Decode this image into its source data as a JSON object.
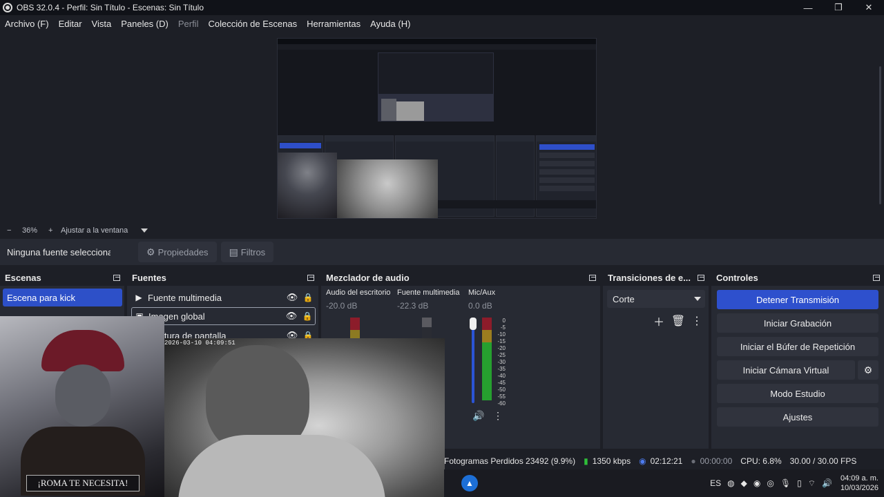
{
  "window": {
    "title": "OBS 32.0.4 - Perfil: Sin Título - Escenas: Sin Título"
  },
  "menu": [
    "Archivo (F)",
    "Editar",
    "Vista",
    "Paneles (D)",
    "Perfil",
    "Colección de Escenas",
    "Herramientas",
    "Ayuda (H)"
  ],
  "zoom": {
    "minus": "−",
    "percent": "36%",
    "plus": "+",
    "fit": "Ajustar a la ventana"
  },
  "context": {
    "no_source": "Ninguna fuente seleccionada",
    "properties": "Propiedades",
    "filters": "Filtros"
  },
  "docks": {
    "scenes": {
      "title": "Escenas",
      "items": [
        "Escena para kick"
      ]
    },
    "sources": {
      "title": "Fuentes",
      "items": [
        "Fuente multimedia",
        "Imagen global",
        "Captura de pantalla"
      ]
    },
    "mixer": {
      "title": "Mezclador de audio",
      "channels": [
        {
          "name": "Audio del escritorio",
          "db": "-20.0 dB"
        },
        {
          "name": "Fuente multimedia",
          "db": "-22.3 dB"
        },
        {
          "name": "Mic/Aux",
          "db": "0.0 dB"
        }
      ],
      "scale": [
        "0",
        "-5",
        "-10",
        "-15",
        "-20",
        "-25",
        "-30",
        "-35",
        "-40",
        "-45",
        "-50",
        "-55",
        "-60"
      ]
    },
    "transitions": {
      "title": "Transiciones de e...",
      "selected": "Corte"
    },
    "controls": {
      "title": "Controles",
      "buttons": [
        "Detener Transmisión",
        "Iniciar Grabación",
        "Iniciar el Búfer de Repetición",
        "Iniciar Cámara Virtual",
        "Modo Estudio",
        "Ajustes"
      ]
    }
  },
  "status": {
    "dropped": "Fotogramas Perdidos 23492 (9.9%)",
    "bitrate": "1350 kbps",
    "stream_time": "02:12:21",
    "rec_time": "00:00:00",
    "cpu": "CPU: 6.8%",
    "fps": "30.00 / 30.00 FPS"
  },
  "overlay": {
    "banner": "¡ROMA TE NECESITA!",
    "cam_timestamp": "2026-03-10  04:09:51"
  },
  "taskbar": {
    "lang": "ES",
    "time": "04:09 a. m.",
    "date": "10/03/2026"
  },
  "colors": {
    "accent": "#2e50cd",
    "bg": "#1d1f26",
    "panel": "#272a33"
  }
}
